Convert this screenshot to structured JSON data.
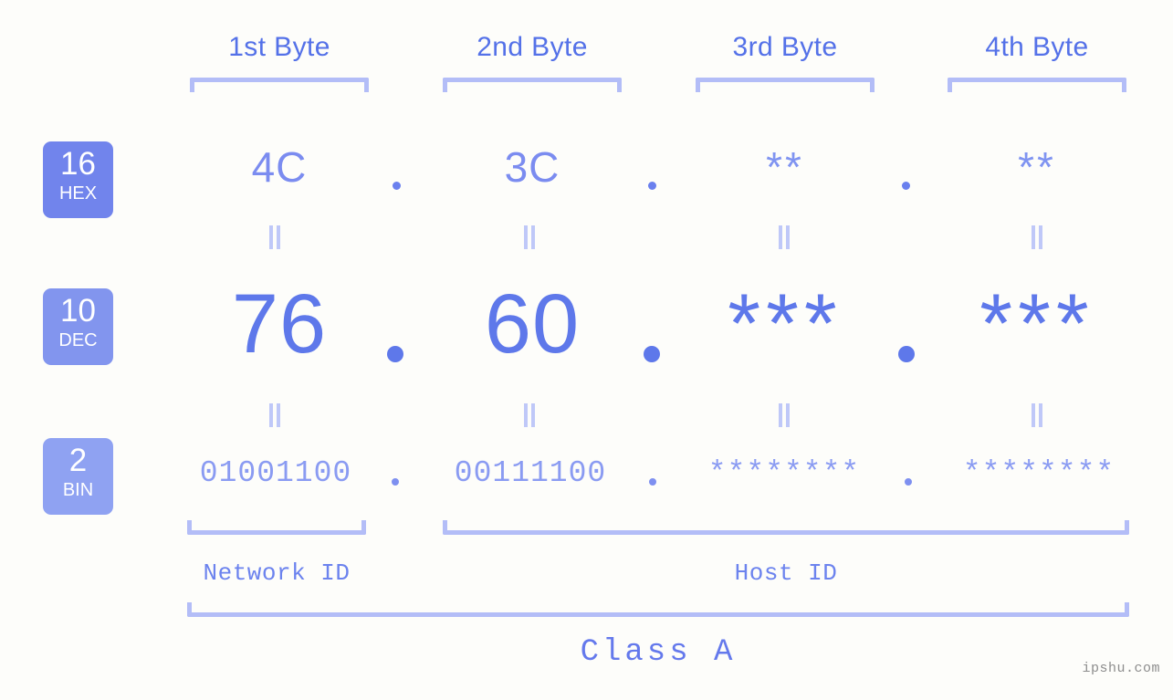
{
  "watermark": "ipshu.com",
  "class_label": "Class A",
  "byte_headers": [
    {
      "label": "1st Byte"
    },
    {
      "label": "2nd Byte"
    },
    {
      "label": "3rd Byte"
    },
    {
      "label": "4th Byte"
    }
  ],
  "bases": [
    {
      "number": "16",
      "name": "HEX",
      "color": "#7184ec"
    },
    {
      "number": "10",
      "name": "DEC",
      "color": "#8295ee"
    },
    {
      "number": "2",
      "name": "BIN",
      "color": "#8fa2f2"
    }
  ],
  "rows": {
    "hex": {
      "values": [
        "4C",
        "3C",
        "**",
        "**"
      ],
      "separators": [
        ".",
        ".",
        "."
      ]
    },
    "dec": {
      "values": [
        "76",
        "60",
        "***",
        "***"
      ],
      "separators": [
        ".",
        ".",
        "."
      ]
    },
    "bin": {
      "values": [
        "01001100",
        "00111100",
        "********",
        "********"
      ],
      "separators": [
        ".",
        ".",
        "."
      ]
    }
  },
  "equals_marker": "=",
  "id_sections": [
    {
      "label": "Network ID"
    },
    {
      "label": "Host ID"
    }
  ],
  "colors": {
    "background": "#fdfdfa",
    "accent": "#5e78ea",
    "accent_light": "#8a9bf2",
    "bracket": "#b3bdf7",
    "badge_text": "#ffffff",
    "watermark_text": "#8d8d8d"
  }
}
